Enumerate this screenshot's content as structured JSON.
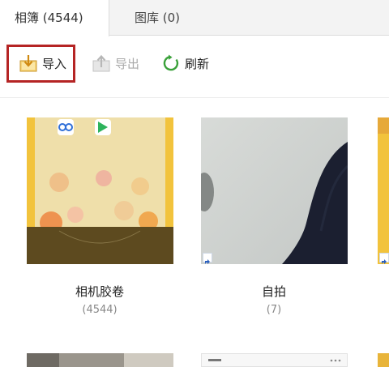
{
  "tabs": [
    {
      "label": "相簿 (4544)",
      "active": true
    },
    {
      "label": "图库 (0)",
      "active": false
    }
  ],
  "toolbar": {
    "import_label": "导入",
    "export_label": "导出",
    "refresh_label": "刷新"
  },
  "albums": [
    {
      "name": "相机胶卷",
      "count": "(4544)"
    },
    {
      "name": "自拍",
      "count": "(7)"
    }
  ],
  "icons": {
    "import": "import-tray-icon",
    "export": "export-tray-icon",
    "refresh": "refresh-icon",
    "shortcut": "shortcut-arrow-icon"
  },
  "colors": {
    "highlight": "#b52424",
    "import_icon": "#e9b43a",
    "refresh_icon": "#3aa13a",
    "disabled_text": "#aaaaaa"
  }
}
